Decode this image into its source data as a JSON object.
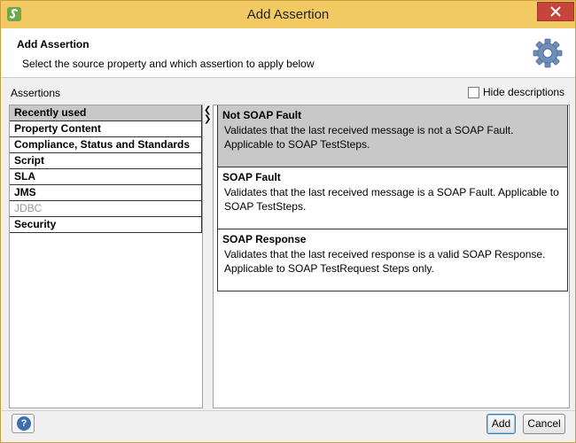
{
  "window": {
    "title": "Add Assertion"
  },
  "header": {
    "title": "Add Assertion",
    "description": "Select the source property and which assertion to apply below"
  },
  "assertions_label": "Assertions",
  "hide_descriptions": {
    "label": "Hide descriptions",
    "checked": false
  },
  "categories": [
    {
      "label": "Recently used",
      "selected": true,
      "enabled": true
    },
    {
      "label": "Property Content",
      "selected": false,
      "enabled": true
    },
    {
      "label": "Compliance, Status and Standards",
      "selected": false,
      "enabled": true
    },
    {
      "label": "Script",
      "selected": false,
      "enabled": true
    },
    {
      "label": "SLA",
      "selected": false,
      "enabled": true
    },
    {
      "label": "JMS",
      "selected": false,
      "enabled": true
    },
    {
      "label": "JDBC",
      "selected": false,
      "enabled": false
    },
    {
      "label": "Security",
      "selected": false,
      "enabled": true
    }
  ],
  "assertions": [
    {
      "name": "Not SOAP Fault",
      "description": "Validates that the last received message is not a SOAP Fault. Applicable to SOAP TestSteps.",
      "selected": true
    },
    {
      "name": "SOAP Fault",
      "description": "Validates that the last received message is a SOAP Fault. Applicable to SOAP TestSteps.",
      "selected": false
    },
    {
      "name": "SOAP Response",
      "description": "Validates that the last received response is a valid SOAP Response. Applicable to SOAP TestRequest Steps only.",
      "selected": false
    }
  ],
  "buttons": {
    "help": "?",
    "add": "Add",
    "cancel": "Cancel"
  },
  "colors": {
    "title_bar": "#f3c961",
    "selection": "#c8c8c8",
    "close_button": "#c7443a"
  }
}
